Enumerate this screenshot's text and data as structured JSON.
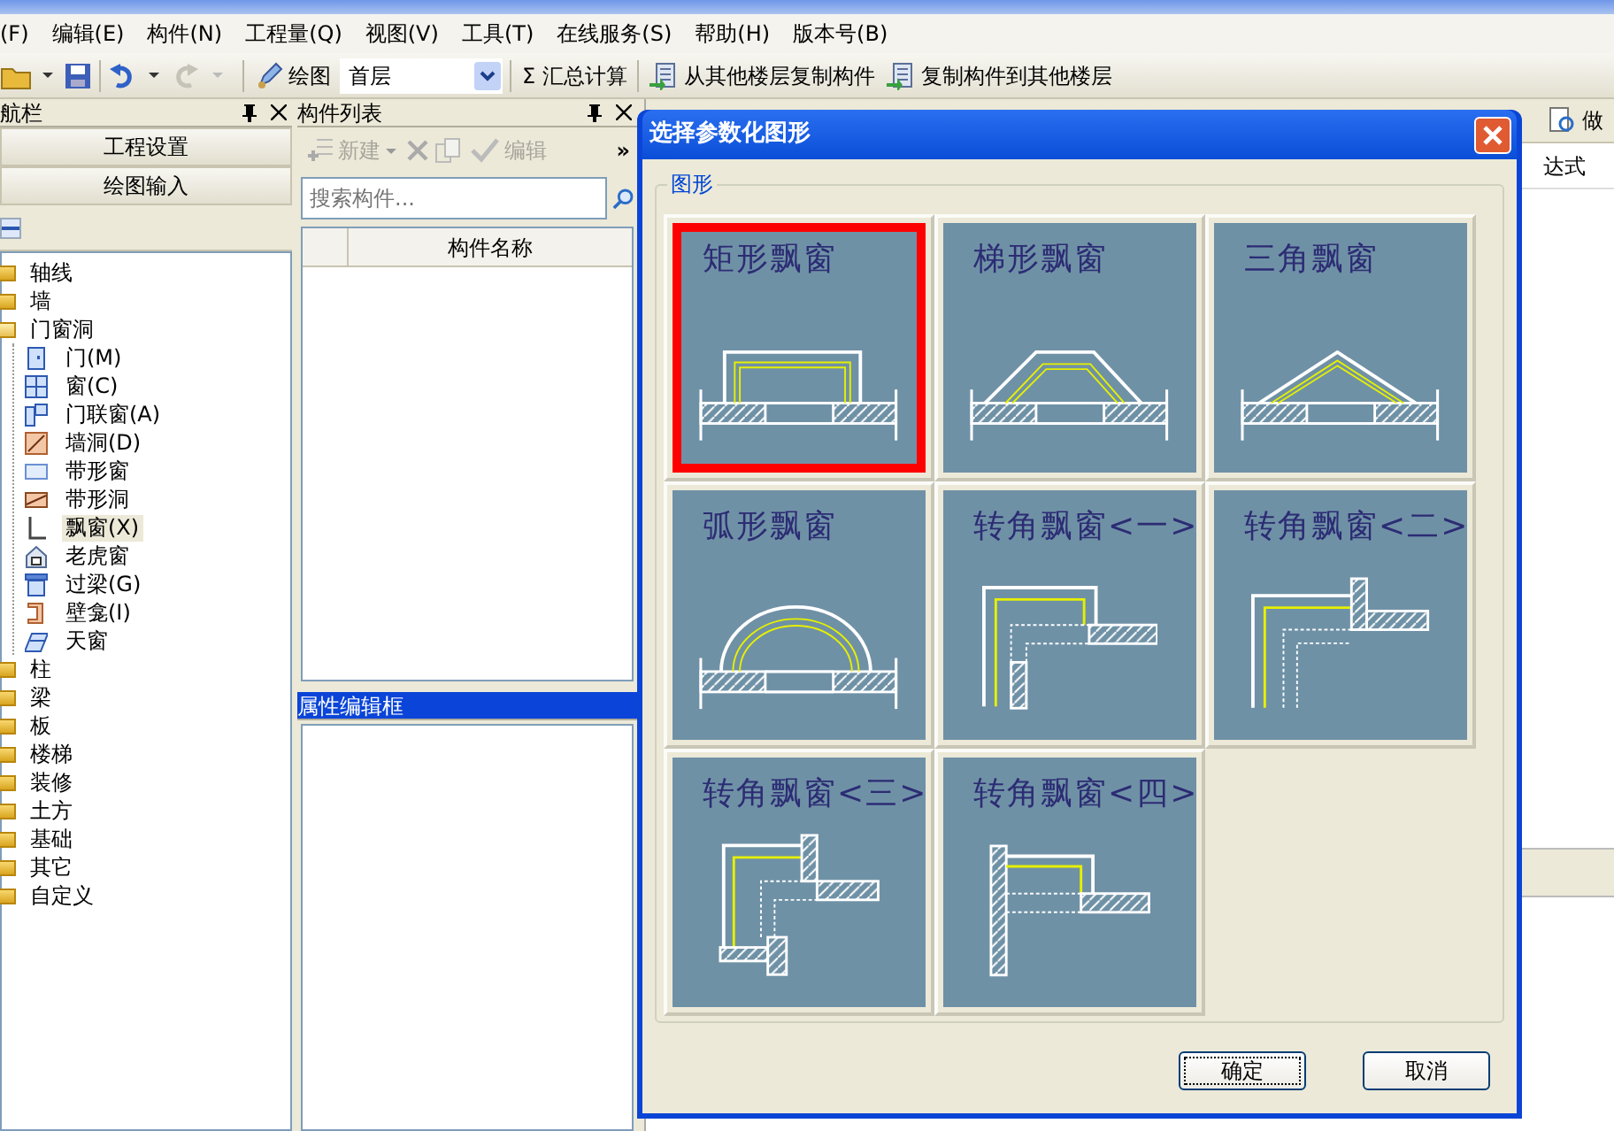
{
  "menu": [
    "(F)",
    "编辑(E)",
    "构件(N)",
    "工程量(Q)",
    "视图(V)",
    "工具(T)",
    "在线服务(S)",
    "帮助(H)",
    "版本号(B)"
  ],
  "toolbar": {
    "draw_label": "绘图",
    "floor": "首层",
    "sum_symbol": "Σ",
    "sum_label": "汇总计算",
    "copy_from": "从其他楼层复制构件",
    "copy_to": "复制构件到其他楼层"
  },
  "nav_panel": {
    "title": "航栏",
    "buttons": [
      "工程设置",
      "绘图输入"
    ],
    "tree": [
      {
        "label": "轴线",
        "expanded": false,
        "selected": false
      },
      {
        "label": "墙",
        "expanded": false,
        "selected": false
      },
      {
        "label": "门窗洞",
        "expanded": true,
        "selected": false,
        "children": [
          {
            "label": "门(M)",
            "selected": false
          },
          {
            "label": "窗(C)",
            "selected": false
          },
          {
            "label": "门联窗(A)",
            "selected": false
          },
          {
            "label": "墙洞(D)",
            "selected": false
          },
          {
            "label": "带形窗",
            "selected": false
          },
          {
            "label": "带形洞",
            "selected": false
          },
          {
            "label": "飘窗(X)",
            "selected": true
          },
          {
            "label": "老虎窗",
            "selected": false
          },
          {
            "label": "过梁(G)",
            "selected": false
          },
          {
            "label": "壁龛(I)",
            "selected": false
          },
          {
            "label": "天窗",
            "selected": false
          }
        ]
      },
      {
        "label": "柱",
        "expanded": false,
        "selected": false
      },
      {
        "label": "梁",
        "expanded": false,
        "selected": false
      },
      {
        "label": "板",
        "expanded": false,
        "selected": false
      },
      {
        "label": "楼梯",
        "expanded": false,
        "selected": false
      },
      {
        "label": "装修",
        "expanded": false,
        "selected": false
      },
      {
        "label": "土方",
        "expanded": false,
        "selected": false
      },
      {
        "label": "基础",
        "expanded": false,
        "selected": false
      },
      {
        "label": "其它",
        "expanded": false,
        "selected": false
      },
      {
        "label": "自定义",
        "expanded": false,
        "selected": false
      }
    ]
  },
  "component_list": {
    "title": "构件列表",
    "actions": [
      {
        "label": "新建",
        "disabled": true
      },
      {
        "label": "编辑",
        "disabled": true
      }
    ],
    "more": "»",
    "search": {
      "placeholder": "搜索构件..."
    },
    "columns": [
      "构件名称"
    ]
  },
  "property_panel": {
    "title": "属性编辑框"
  },
  "right_panel": {
    "toolbar_text": "做",
    "column_text": "达式"
  },
  "dialog": {
    "title": "选择参数化图形",
    "group_label": "图形",
    "shapes": [
      {
        "label": "矩形飘窗",
        "kind": "rect",
        "selected": true
      },
      {
        "label": "梯形飘窗",
        "kind": "trapezoid",
        "selected": false
      },
      {
        "label": "三角飘窗",
        "kind": "triangle",
        "selected": false
      },
      {
        "label": "弧形飘窗",
        "kind": "arc",
        "selected": false
      },
      {
        "label": "转角飘窗<一>",
        "kind": "corner1",
        "selected": false
      },
      {
        "label": "转角飘窗<二>",
        "kind": "corner2",
        "selected": false
      },
      {
        "label": "转角飘窗<三>",
        "kind": "corner3",
        "selected": false
      },
      {
        "label": "转角飘窗<四>",
        "kind": "corner4",
        "selected": false
      }
    ],
    "buttons": [
      {
        "label": "确定",
        "focused": true
      },
      {
        "label": "取消",
        "focused": false
      }
    ]
  }
}
